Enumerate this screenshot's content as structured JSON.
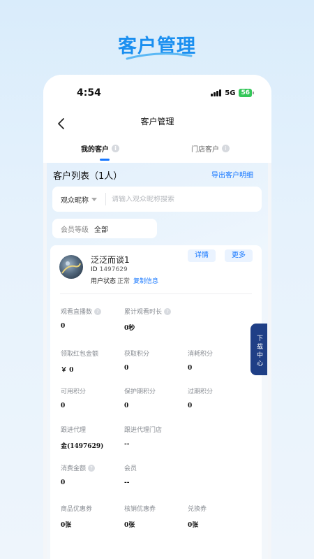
{
  "banner": {
    "title": "客户管理"
  },
  "status_bar": {
    "time": "4:54",
    "network": "5G",
    "battery": "56"
  },
  "nav": {
    "title": "客户管理"
  },
  "tabs": [
    {
      "label": "我的客户"
    },
    {
      "label": "门店客户"
    }
  ],
  "list": {
    "title": "客户列表（1人）",
    "export_label": "导出客户明细"
  },
  "search": {
    "type_label": "观众昵称",
    "placeholder": "请输入观众昵称搜索",
    "value": ""
  },
  "filter": {
    "level_label": "会员等级",
    "level_value": "全部"
  },
  "customer": {
    "name": "泛泛而谈1",
    "id_label": "ID",
    "id_value": "1497629",
    "state_label": "用户状态",
    "state_value": "正常",
    "copy_label": "复制信息",
    "detail_label": "详情",
    "more_label": "更多"
  },
  "stats": {
    "watch_count": {
      "label": "观看直播数",
      "value": "0"
    },
    "watch_time": {
      "label": "累计观看时长",
      "value": "0秒"
    },
    "red_packet": {
      "label": "领取红包金额",
      "value": "￥ 0"
    },
    "points_got": {
      "label": "获取积分",
      "value": "0"
    },
    "points_used": {
      "label": "消耗积分",
      "value": "0"
    },
    "points_avail": {
      "label": "可用积分",
      "value": "0"
    },
    "points_protect": {
      "label": "保护期积分",
      "value": "0"
    },
    "points_expired": {
      "label": "过期积分",
      "value": "0"
    },
    "agent": {
      "label": "跟进代理",
      "value": "金(1497629)"
    },
    "agent_store": {
      "label": "跟进代理门店",
      "value": "--"
    },
    "spend": {
      "label": "消费金额",
      "value": "0"
    },
    "member": {
      "label": "会员",
      "value": "--"
    },
    "coupons": {
      "label": "商品优惠券",
      "value": "0张"
    },
    "redeem_coupons": {
      "label": "核销优惠券",
      "value": "0张"
    },
    "exchange": {
      "label": "兑换券",
      "value": "0张"
    }
  },
  "side_tab": {
    "label": "下载中心"
  },
  "icons": [
    "back-arrow-icon",
    "info-icon",
    "question-icon",
    "dropdown-caret-icon",
    "signal-icon",
    "battery-icon"
  ],
  "colors": {
    "accent": "#1677ff",
    "banner": "#1a8ff0",
    "side_tab": "#1f3f86"
  }
}
